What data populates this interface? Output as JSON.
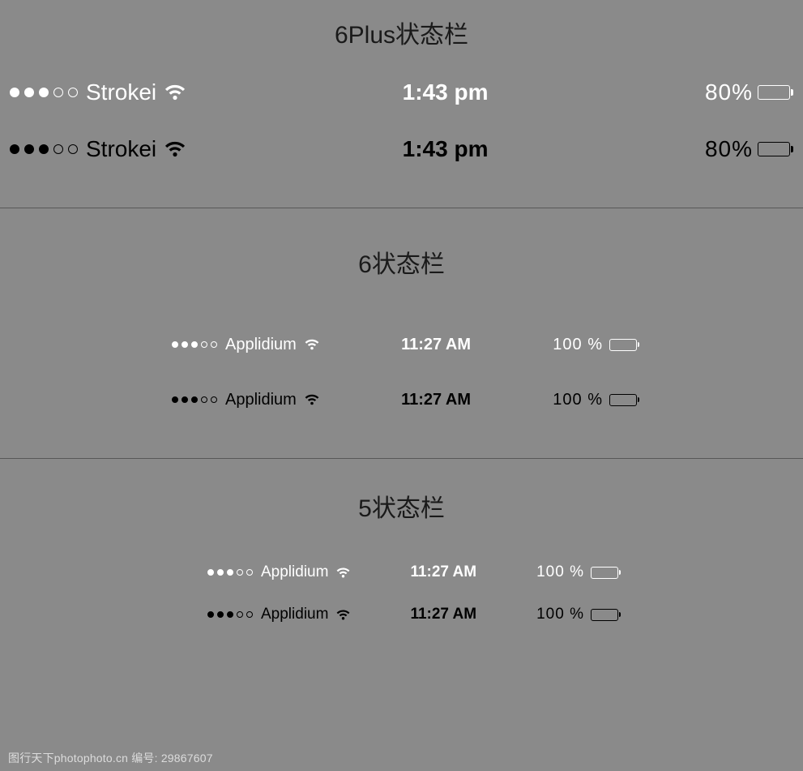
{
  "sections": {
    "six_plus": {
      "title": "6Plus状态栏",
      "bars": [
        {
          "theme": "white",
          "carrier": "Strokei",
          "time": "1:43 pm",
          "battery_text": "80%",
          "battery_fill_pct": 80,
          "signal_filled": 3,
          "signal_total": 5
        },
        {
          "theme": "black",
          "carrier": "Strokei",
          "time": "1:43 pm",
          "battery_text": "80%",
          "battery_fill_pct": 80,
          "signal_filled": 3,
          "signal_total": 5
        }
      ]
    },
    "six": {
      "title": "6状态栏",
      "bars": [
        {
          "theme": "white",
          "carrier": "Applidium",
          "time": "11:27 AM",
          "battery_text": "100 %",
          "battery_fill_pct": 100,
          "signal_filled": 3,
          "signal_total": 5
        },
        {
          "theme": "black",
          "carrier": "Applidium",
          "time": "11:27 AM",
          "battery_text": "100 %",
          "battery_fill_pct": 100,
          "signal_filled": 3,
          "signal_total": 5
        }
      ]
    },
    "five": {
      "title": "5状态栏",
      "bars": [
        {
          "theme": "white",
          "carrier": "Applidium",
          "time": "11:27 AM",
          "battery_text": "100 %",
          "battery_fill_pct": 100,
          "signal_filled": 3,
          "signal_total": 5
        },
        {
          "theme": "black",
          "carrier": "Applidium",
          "time": "11:27 AM",
          "battery_text": "100 %",
          "battery_fill_pct": 100,
          "signal_filled": 3,
          "signal_total": 5
        }
      ]
    }
  },
  "watermark": "图行天下photophoto.cn  编号: 29867607"
}
